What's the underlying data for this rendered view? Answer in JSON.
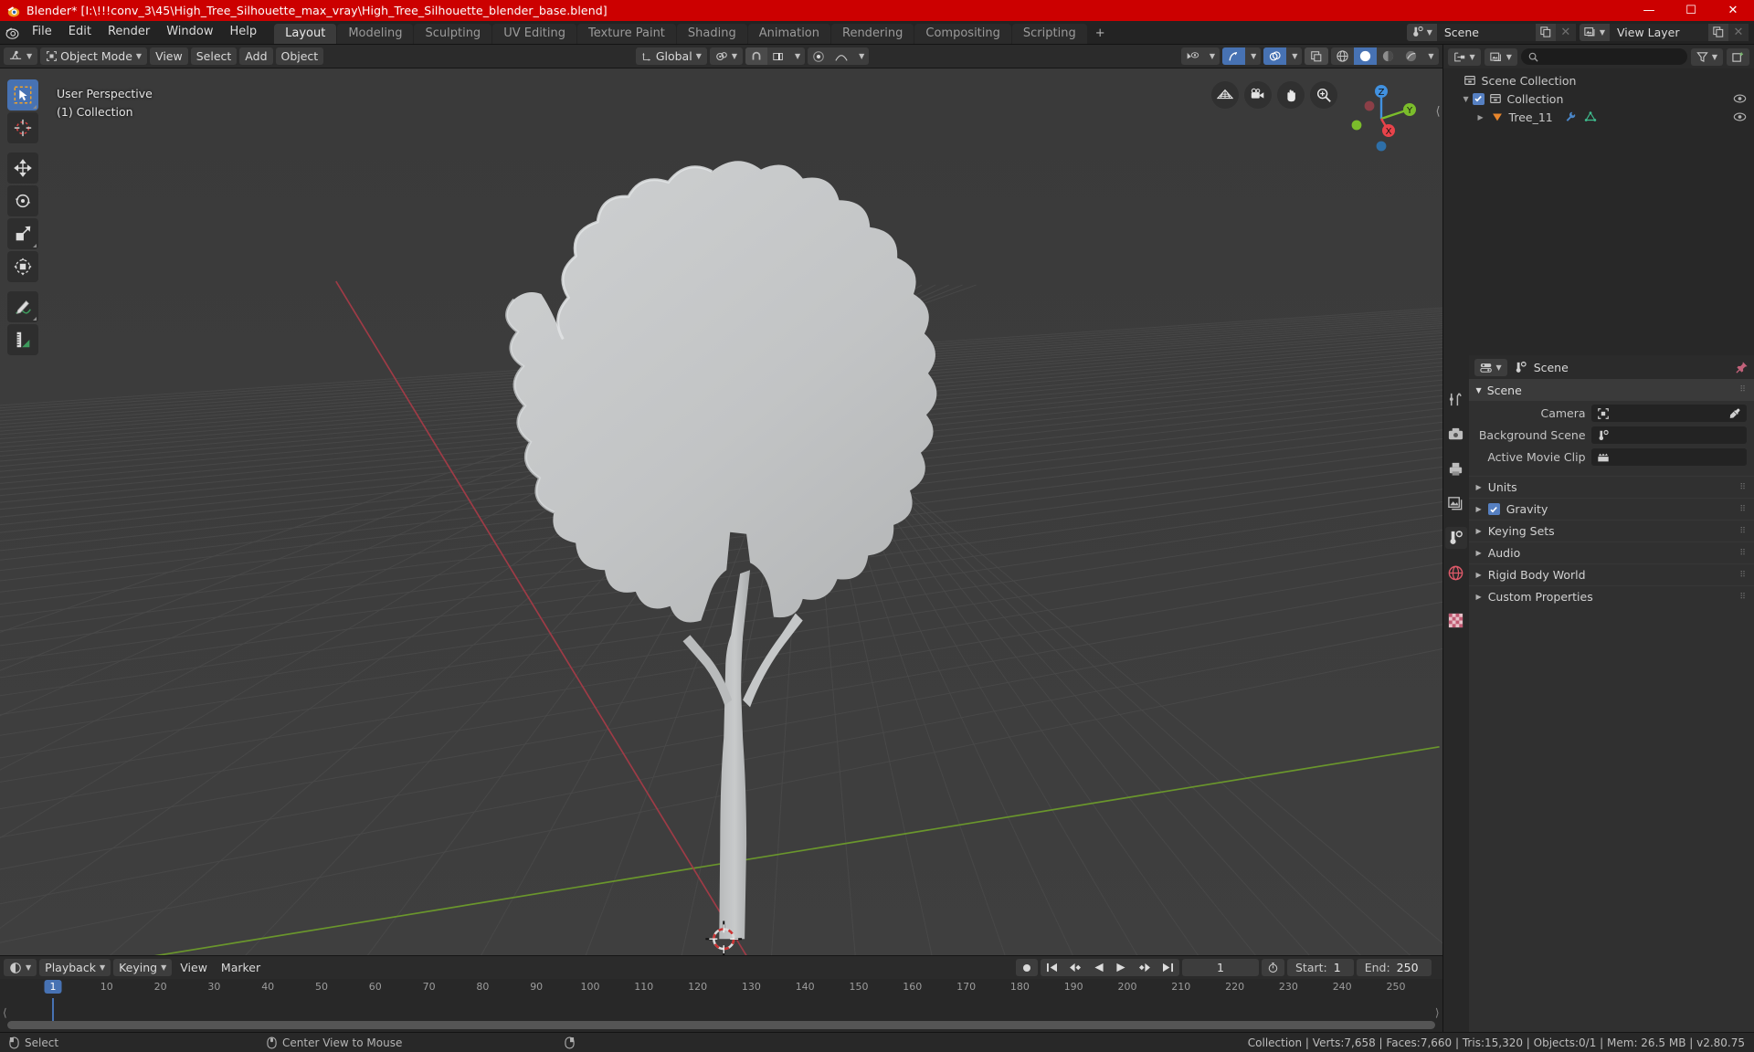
{
  "titlebar": {
    "title": "Blender* [I:\\!!!conv_3\\45\\High_Tree_Silhouette_max_vray\\High_Tree_Silhouette_blender_base.blend]",
    "minimize": "—",
    "maximize": "☐",
    "close": "✕",
    "app_icon": "blender-logo-icon"
  },
  "topbar": {
    "menus": [
      "File",
      "Edit",
      "Render",
      "Window",
      "Help"
    ],
    "workspaces": [
      {
        "label": "Layout",
        "active": true
      },
      {
        "label": "Modeling",
        "active": false
      },
      {
        "label": "Sculpting",
        "active": false
      },
      {
        "label": "UV Editing",
        "active": false
      },
      {
        "label": "Texture Paint",
        "active": false
      },
      {
        "label": "Shading",
        "active": false
      },
      {
        "label": "Animation",
        "active": false
      },
      {
        "label": "Rendering",
        "active": false
      },
      {
        "label": "Compositing",
        "active": false
      },
      {
        "label": "Scripting",
        "active": false
      }
    ],
    "add_workspace": "+",
    "scene_selector": {
      "value": "Scene",
      "icon": "scene-icon",
      "new_btn": "copy-icon",
      "close_btn": "✕"
    },
    "viewlayer_selector": {
      "value": "View Layer",
      "icon": "viewlayer-icon",
      "new_btn": "copy-icon",
      "close_btn": "✕"
    }
  },
  "viewport_header": {
    "editor_type": "editor-type-3dview-icon",
    "mode": "Object Mode",
    "menus": [
      "View",
      "Select",
      "Add",
      "Object"
    ],
    "transform_orientation": "Global",
    "pivot": "pivot-icon",
    "snap": "magnet-icon",
    "snap_target": "snap-increment-icon",
    "proportional_edit": "proportional-edit-icon",
    "falloff": "smooth-falloff-icon",
    "visibility_icon": "object-visibility-icon",
    "gizmo_icon": "gizmo-icon",
    "overlays_icon": "overlays-icon",
    "xray_icon": "xray-toggle-icon",
    "shading_modes": [
      "wireframe",
      "solid",
      "material-preview",
      "rendered"
    ],
    "shading_active": "solid"
  },
  "viewport": {
    "overlay_line1": "User Perspective",
    "overlay_line2": "(1) Collection",
    "toolbar_tools": [
      "select-box-tool",
      "cursor-tool",
      "move-tool",
      "rotate-tool",
      "scale-tool",
      "transform-tool",
      "annotate-tool",
      "measure-tool"
    ],
    "nav_icons": [
      "grid-view-icon",
      "camera-view-icon",
      "pan-view-icon",
      "zoom-view-icon"
    ],
    "gizmo_axes": [
      {
        "label": "Z",
        "color": "#4191e0"
      },
      {
        "label": "Y",
        "color": "#7bbd2b"
      },
      {
        "label": "X",
        "color": "#e8434a"
      }
    ],
    "object_name": "Tree_11",
    "background_color": "#3b3b3b",
    "model_color": "#c4c6c7"
  },
  "outliner": {
    "display_mode_icon": "outliner-display-mode-icon",
    "scene_filter_icon": "viewlayer-icon",
    "search_placeholder": "",
    "search_icon": "search-icon",
    "filter_icon": "filter-icon",
    "new_collection_icon": "new-collection-icon",
    "rows": [
      {
        "label": "Scene Collection",
        "icon": "collection-icon",
        "depth": 0,
        "checkbox": false,
        "eye": false,
        "disclosure": ""
      },
      {
        "label": "Collection",
        "icon": "collection-icon",
        "depth": 1,
        "checkbox": true,
        "eye": true,
        "disclosure": "▼"
      },
      {
        "label": "Tree_11",
        "icon": "mesh-object-icon",
        "depth": 2,
        "checkbox": false,
        "eye": true,
        "disclosure": "▶",
        "badges": [
          "modifier-wrench-icon",
          "mesh-data-icon"
        ]
      }
    ]
  },
  "properties": {
    "editor_icon": "properties-editor-icon",
    "breadcrumb": "Scene",
    "breadcrumb_icon": "scene-icon",
    "pin_icon": "pin-icon",
    "tabs": [
      {
        "name": "tool-tab",
        "active": false
      },
      {
        "name": "render-tab",
        "active": false
      },
      {
        "name": "output-tab",
        "active": false
      },
      {
        "name": "view-layer-tab",
        "active": false
      },
      {
        "name": "scene-tab",
        "active": true
      },
      {
        "name": "world-tab",
        "active": false
      },
      {
        "name": "texture-tab",
        "active": false
      }
    ],
    "panel_title": "Scene",
    "fields": [
      {
        "label": "Camera",
        "icon": "camera-data-icon",
        "value": "",
        "eyedropper": true
      },
      {
        "label": "Background Scene",
        "icon": "scene-icon",
        "value": "",
        "eyedropper": false
      },
      {
        "label": "Active Movie Clip",
        "icon": "movieclip-icon",
        "value": "",
        "eyedropper": false
      }
    ],
    "accordions": [
      {
        "label": "Units",
        "checkbox": null
      },
      {
        "label": "Gravity",
        "checkbox": true
      },
      {
        "label": "Keying Sets",
        "checkbox": null
      },
      {
        "label": "Audio",
        "checkbox": null
      },
      {
        "label": "Rigid Body World",
        "checkbox": null
      },
      {
        "label": "Custom Properties",
        "checkbox": null
      }
    ]
  },
  "timeline": {
    "editor_icon": "timeline-editor-icon",
    "menus": [
      "Playback",
      "Keying",
      "View",
      "Marker"
    ],
    "transport": [
      "record-icon",
      "jump-start-icon",
      "prev-keyframe-icon",
      "play-reverse-icon",
      "play-icon",
      "next-keyframe-icon",
      "jump-end-icon"
    ],
    "current_frame": "1",
    "autokey_icon": "stopwatch-icon",
    "start_label": "Start:",
    "start_value": "1",
    "end_label": "End:",
    "end_value": "250",
    "tick_labels": [
      "1",
      "10",
      "20",
      "30",
      "40",
      "50",
      "60",
      "70",
      "80",
      "90",
      "100",
      "110",
      "120",
      "130",
      "140",
      "150",
      "160",
      "170",
      "180",
      "190",
      "200",
      "210",
      "220",
      "230",
      "240",
      "250"
    ],
    "playhead_frame": "1"
  },
  "statusbar": {
    "left_items": [
      {
        "icon": "mouse-left-icon",
        "label": "Select"
      },
      {
        "icon": "mouse-middle-icon",
        "label": "Center View to Mouse"
      },
      {
        "icon": "mouse-right-icon",
        "label": ""
      }
    ],
    "stats": "Collection | Verts:7,658 | Faces:7,660 | Tris:15,320 | Objects:0/1 | Mem: 26.5 MB | v2.80.75"
  }
}
